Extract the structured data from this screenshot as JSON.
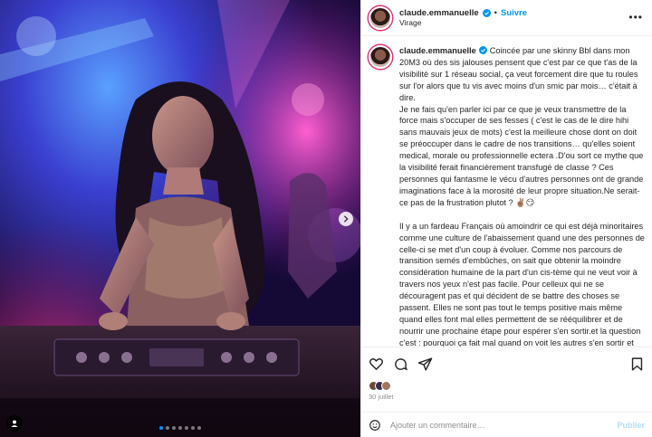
{
  "header": {
    "username": "claude.emmanuelle",
    "separator": "•",
    "follow_label": "Suivre",
    "location": "Virage",
    "more_icon": "more-horizontal-icon"
  },
  "caption": {
    "username": "claude.emmanuelle",
    "paragraphs": [
      "Coincée par une skinny Bbl dans mon 20M3 où des sis jalouses pensent que c'est par ce que t'as de la visibilité sur 1 réseau social, ça veut forcement dire que tu roules sur l'or alors que tu vis avec moins d'un smic par mois… c'était à dire.",
      "Je ne fais qu'en parler ici par ce que je veux transmettre de la force mais s'occuper de ses fesses ( c'est le cas de le dire hihi sans mauvais jeux de mots) c'est la meilleure chose dont on doit se préoccuper dans le cadre de nos transitions… qu'elles soient medical, morale ou professionnelle ectera .D'ou sort ce mythe que la visibilité ferait financièrement transfugé de classe ? Ces personnes qui fantasme le vécu d'autres personnes ont de grande imaginations face à la morosité de leur propre situation.Ne serait-ce pas de la frustration plutot ? ✌🏽😏",
      "Il y a un fardeau Français où amoindrir ce qui est déjà minoritaires comme une culture de l'abaissement quand une des personnes de celle-ci se met d'un coup à évoluer. Comme nos parcours de transition semés d'embûches, on sait que obtenir la moindre considération humaine de la part d'un cis-tème qui ne veut voir à travers nos yeux n'est pas facile. Pour celleux qui ne se découragent pas et qui décident de se battre des choses se passent. Elles ne sont pas tout le temps positive mais même quand elles font mal elles permettent de se rééquilibrer et de nourrir une prochaine étape pour espérer s'en sortir.et la question c'est : pourquoi ça fait mal quand on voit les autres s'en sortir et pas soi ?Pour ma part c'est"
    ]
  },
  "actions": {
    "like_icon": "heart-icon",
    "comment_icon": "comment-icon",
    "share_icon": "share-icon",
    "save_icon": "bookmark-icon"
  },
  "likes": {
    "date": "30 juillet"
  },
  "comment_box": {
    "placeholder": "Ajouter un commentaire…",
    "publish_label": "Publier",
    "emoji_icon": "smiley-icon"
  },
  "carousel": {
    "slide_count": 7,
    "active_index": 0
  },
  "colors": {
    "accent": "#0095f6",
    "text": "#262626",
    "muted": "#8e8e8e"
  }
}
